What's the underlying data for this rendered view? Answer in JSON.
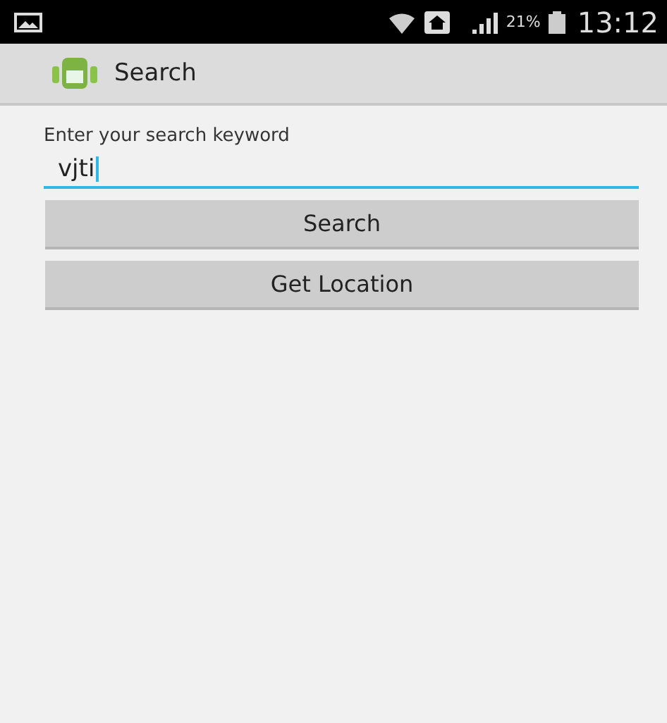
{
  "status_bar": {
    "battery_percent": "21%",
    "time": "13:12"
  },
  "action_bar": {
    "title": "Search"
  },
  "search": {
    "label": "Enter your search keyword",
    "value": "vjti"
  },
  "buttons": [
    "Search",
    "Get Location"
  ]
}
